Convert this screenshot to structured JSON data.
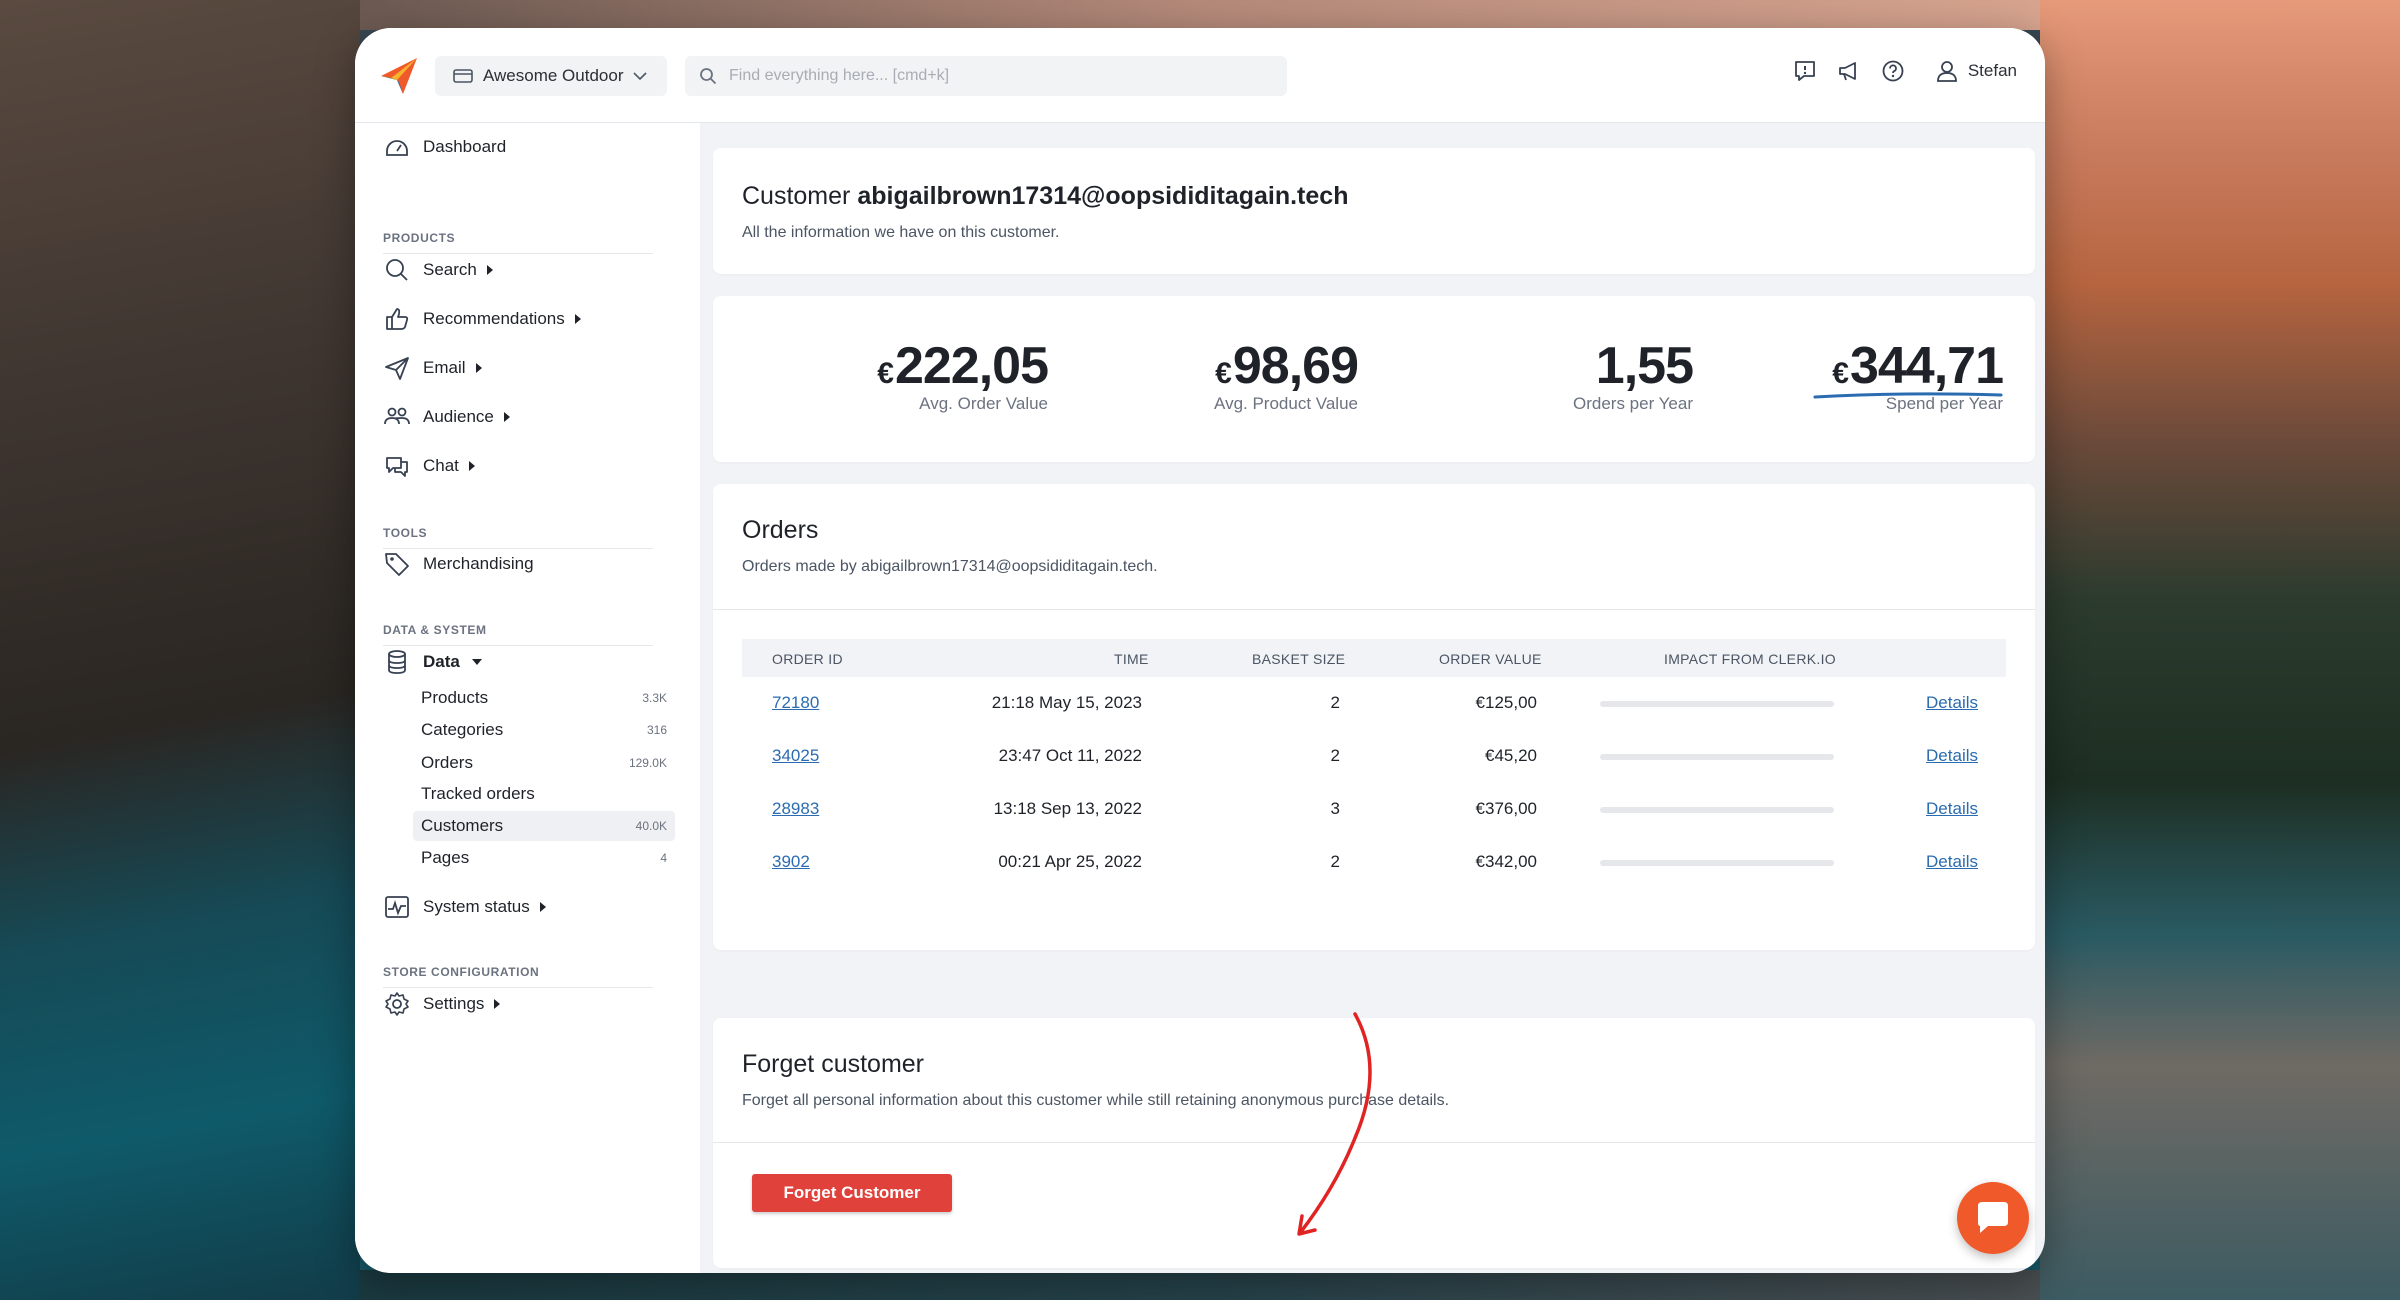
{
  "header": {
    "store_name": "Awesome Outdoor",
    "search_placeholder": "Find everything here... [cmd+k]",
    "user_name": "Stefan"
  },
  "sidebar": {
    "dashboard": "Dashboard",
    "sections": {
      "products": "PRODUCTS",
      "tools": "TOOLS",
      "data_system": "DATA & SYSTEM",
      "store_config": "STORE CONFIGURATION"
    },
    "items": {
      "search": "Search",
      "recommendations": "Recommendations",
      "email": "Email",
      "audience": "Audience",
      "chat": "Chat",
      "merchandising": "Merchandising",
      "data": "Data",
      "system_status": "System status",
      "settings": "Settings"
    },
    "data_sub": [
      {
        "label": "Products",
        "count": "3.3K"
      },
      {
        "label": "Categories",
        "count": "316"
      },
      {
        "label": "Orders",
        "count": "129.0K"
      },
      {
        "label": "Tracked orders",
        "count": ""
      },
      {
        "label": "Customers",
        "count": "40.0K"
      },
      {
        "label": "Pages",
        "count": "4"
      }
    ]
  },
  "customer": {
    "title_prefix": "Customer",
    "email": "abigailbrown17314@oopsididitagain.tech",
    "subtitle": "All the information we have on this customer."
  },
  "stats": [
    {
      "currency": "€",
      "value": "222,05",
      "label": "Avg. Order Value"
    },
    {
      "currency": "€",
      "value": "98,69",
      "label": "Avg. Product Value"
    },
    {
      "currency": "",
      "value": "1,55",
      "label": "Orders per Year"
    },
    {
      "currency": "€",
      "value": "344,71",
      "label": "Spend per Year"
    }
  ],
  "orders": {
    "title": "Orders",
    "subtitle": "Orders made by abigailbrown17314@oopsididitagain.tech.",
    "columns": [
      "ORDER ID",
      "TIME",
      "BASKET SIZE",
      "ORDER VALUE",
      "IMPACT FROM CLERK.IO"
    ],
    "rows": [
      {
        "id": "72180",
        "time": "21:18 May 15, 2023",
        "basket": "2",
        "value": "€125,00",
        "action": "Details"
      },
      {
        "id": "34025",
        "time": "23:47 Oct 11, 2022",
        "basket": "2",
        "value": "€45,20",
        "action": "Details"
      },
      {
        "id": "28983",
        "time": "13:18 Sep 13, 2022",
        "basket": "3",
        "value": "€376,00",
        "action": "Details"
      },
      {
        "id": "3902",
        "time": "00:21 Apr 25, 2022",
        "basket": "2",
        "value": "€342,00",
        "action": "Details"
      }
    ]
  },
  "forget": {
    "title": "Forget customer",
    "subtitle": "Forget all personal information about this customer while still retaining anonymous purchase details.",
    "button": "Forget Customer"
  },
  "colors": {
    "accent": "#2b6cb0",
    "danger": "#e0413a",
    "chat": "#f05a2a",
    "annotation": "#e02424"
  }
}
